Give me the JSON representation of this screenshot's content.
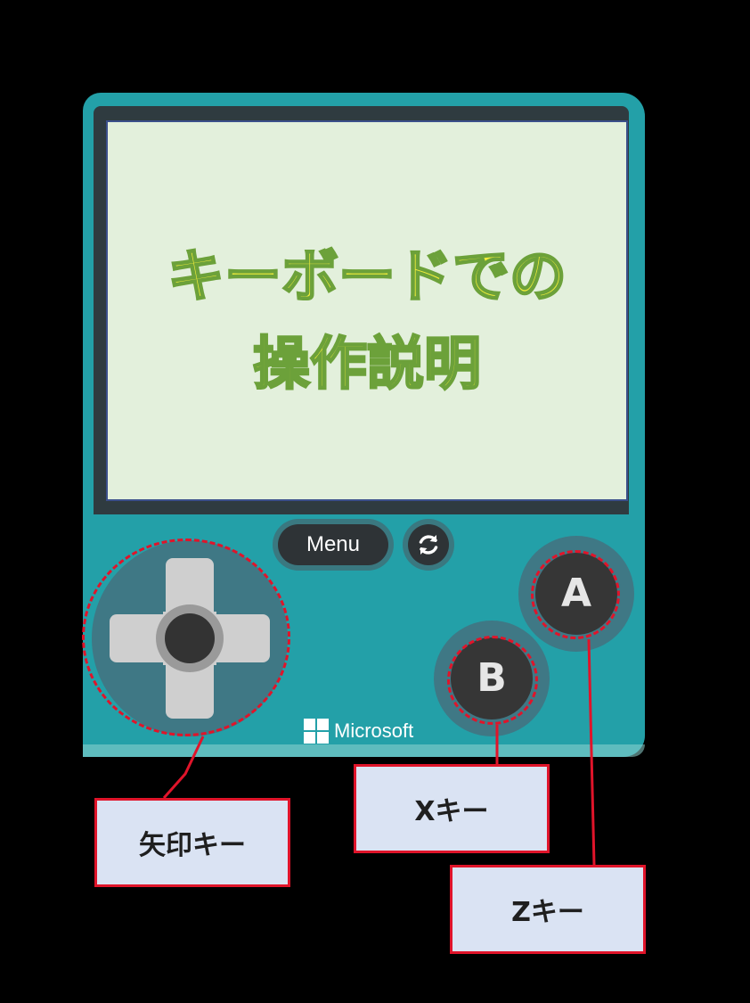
{
  "screen": {
    "title_line1": "キーボードでの",
    "title_line2": "操作説明",
    "title_color": "#f3ee3a",
    "background_color": "#e3f0dc"
  },
  "console": {
    "body_color": "#23a0a8",
    "menu_label": "Menu",
    "restart_icon": "refresh-icon",
    "dpad_icon": "dpad-icon",
    "button_a_label": "A",
    "button_b_label": "B",
    "brand_logo": "microsoft-logo",
    "brand_text": "Microsoft"
  },
  "callouts": {
    "arrow_keys": "矢印キー",
    "x_key": "Xキー",
    "z_key": "Zキー",
    "highlight_color": "#e0142a"
  }
}
